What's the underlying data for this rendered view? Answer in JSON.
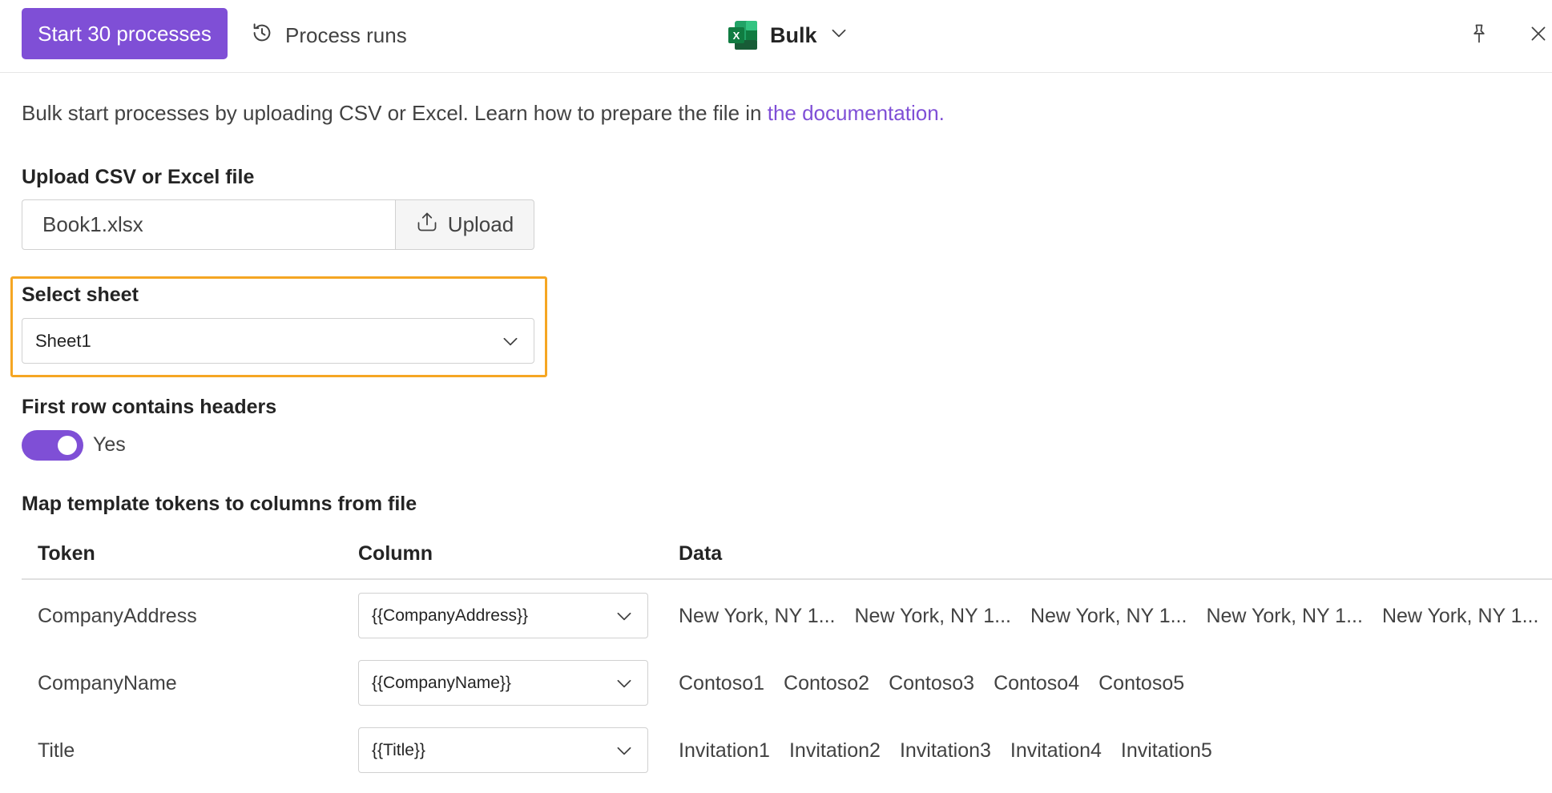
{
  "toolbar": {
    "primary_button": "Start 30 processes",
    "runs_link": "Process runs",
    "mode_label": "Bulk",
    "excel_letter": "X",
    "icons": {
      "runs": "history-icon",
      "mode": "excel-icon",
      "pin": "pin-icon",
      "close": "close-icon"
    }
  },
  "intro": {
    "text": "Bulk start processes by uploading CSV or Excel. Learn how to prepare the file in ",
    "link": "the documentation."
  },
  "upload": {
    "label": "Upload CSV or Excel file",
    "file_name": "Book1.xlsx",
    "button": "Upload"
  },
  "sheet": {
    "label": "Select sheet",
    "selected": "Sheet1"
  },
  "headers_toggle": {
    "label": "First row contains headers",
    "state": "Yes",
    "on": true
  },
  "mapping": {
    "title": "Map template tokens to columns from file",
    "columns": [
      "Token",
      "Column",
      "Data"
    ],
    "rows": [
      {
        "token": "CompanyAddress",
        "column": "{{CompanyAddress}}",
        "data": [
          "New York, NY 1...",
          "New York, NY 1...",
          "New York, NY 1...",
          "New York, NY 1...",
          "New York, NY 1..."
        ]
      },
      {
        "token": "CompanyName",
        "column": "{{CompanyName}}",
        "data": [
          "Contoso1",
          "Contoso2",
          "Contoso3",
          "Contoso4",
          "Contoso5"
        ]
      },
      {
        "token": "Title",
        "column": "{{Title}}",
        "data": [
          "Invitation1",
          "Invitation2",
          "Invitation3",
          "Invitation4",
          "Invitation5"
        ]
      }
    ]
  },
  "colors": {
    "accent": "#7f4fd6",
    "highlight": "#f5a623",
    "excel_green": "#107c41"
  }
}
